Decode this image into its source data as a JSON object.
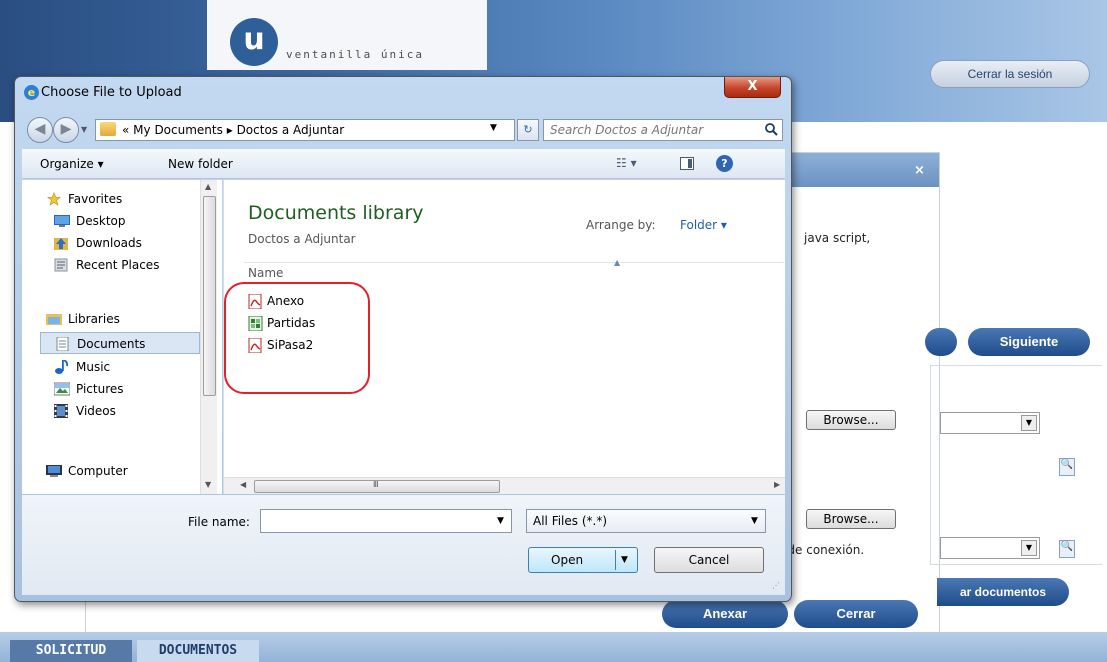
{
  "web": {
    "logo_letter": "u",
    "logo_text": "ventanilla única",
    "logout_label": "Cerrar la sesión",
    "modal_close": "×",
    "js_text": "java script,",
    "connection_text": "d de conexión.",
    "next_label": "Siguiente",
    "attach_docs_label": "ar documentos",
    "anexar_label": "Anexar",
    "cerrar_label": "Cerrar",
    "browse_label": "Browse...",
    "tabs": [
      {
        "label": "SOLICITUD"
      },
      {
        "label": "DOCUMENTOS"
      }
    ]
  },
  "dialog": {
    "title": "Choose File to Upload",
    "close_glyph": "X",
    "address": {
      "prefix": "«",
      "crumbs": [
        "My Documents",
        "Doctos a Adjuntar"
      ],
      "separator": "▸"
    },
    "search_placeholder": "Search Doctos a Adjuntar",
    "toolbar": {
      "organize_label": "Organize ▾",
      "new_folder_label": "New folder",
      "view_glyph": "☷ ▾",
      "help_glyph": "?"
    },
    "nav": {
      "items": [
        {
          "label": "Favorites",
          "icon": "star-icon",
          "indent": 0
        },
        {
          "label": "Desktop",
          "icon": "desktop-icon",
          "indent": 1
        },
        {
          "label": "Downloads",
          "icon": "downloads-icon",
          "indent": 1
        },
        {
          "label": "Recent Places",
          "icon": "recent-places-icon",
          "indent": 1
        },
        {
          "label": "Libraries",
          "icon": "libraries-icon",
          "indent": 0
        },
        {
          "label": "Documents",
          "icon": "documents-icon",
          "indent": 1,
          "selected": true
        },
        {
          "label": "Music",
          "icon": "music-icon",
          "indent": 1
        },
        {
          "label": "Pictures",
          "icon": "pictures-icon",
          "indent": 1
        },
        {
          "label": "Videos",
          "icon": "videos-icon",
          "indent": 1
        },
        {
          "label": "Computer",
          "icon": "computer-icon",
          "indent": 0
        }
      ]
    },
    "content": {
      "library_title": "Documents library",
      "library_subtitle": "Doctos a Adjuntar",
      "arrange_label": "Arrange by:",
      "arrange_value": "Folder ▾",
      "column_name": "Name",
      "files": [
        {
          "name": "Anexo",
          "type": "pdf"
        },
        {
          "name": "Partidas",
          "type": "excel"
        },
        {
          "name": "SiPasa2",
          "type": "pdf"
        }
      ]
    },
    "footer": {
      "filename_label": "File name:",
      "filename_value": "",
      "filetype_value": "All Files (*.*)",
      "open_label": "Open",
      "cancel_label": "Cancel"
    }
  },
  "colors": {
    "highlight": "#e5202a",
    "library_title": "#1e5e1e",
    "link_blue": "#1f5faa",
    "web_button": "#1f4c8a"
  }
}
